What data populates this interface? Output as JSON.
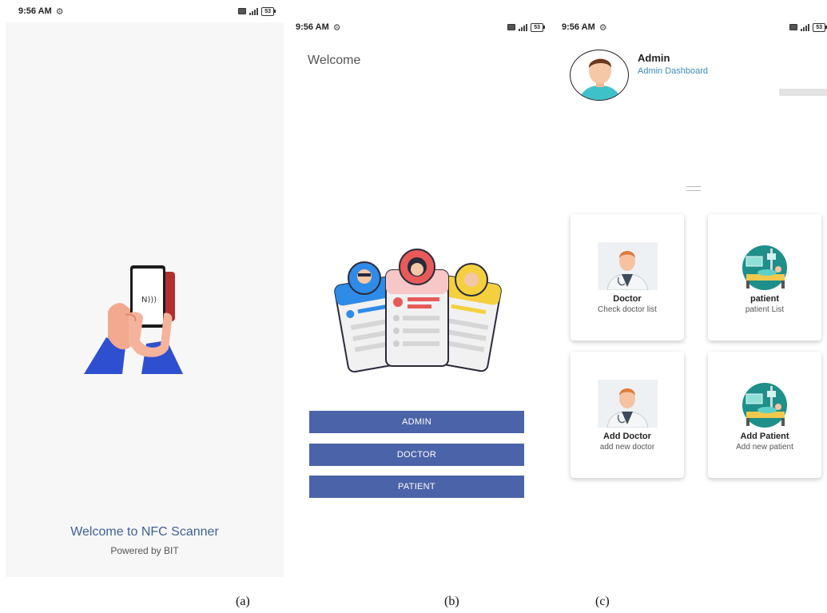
{
  "status_bar": {
    "time": "9:56 AM",
    "battery": "53",
    "icons": [
      "alarm-icon",
      "sim-icon",
      "signal-icon",
      "battery-icon"
    ]
  },
  "screen_a": {
    "title": "Welcome to NFC Scanner",
    "subtitle": "Powered by BIT",
    "illustration": "hand-holding-phone-nfc-icon"
  },
  "screen_b": {
    "heading": "Welcome",
    "illustration": "user-role-cards-icon",
    "buttons": {
      "admin": "ADMIN",
      "doctor": "DOCTOR",
      "patient": "PATIENT"
    },
    "accent": "#4b63a8"
  },
  "screen_c": {
    "user": {
      "name": "Admin",
      "role": "Admin Dashboard"
    },
    "cards": [
      {
        "title": "Doctor",
        "subtitle": "Check doctor list",
        "icon": "doctor-icon"
      },
      {
        "title": "patient",
        "subtitle": "patient List",
        "icon": "patient-bed-icon"
      },
      {
        "title": "Add Doctor",
        "subtitle": "add new doctor",
        "icon": "doctor-icon"
      },
      {
        "title": "Add Patient",
        "subtitle": "Add new patient",
        "icon": "patient-bed-icon"
      }
    ],
    "link_color": "#3a8db5"
  },
  "captions": [
    "(a)",
    "(b)",
    "(c)"
  ]
}
